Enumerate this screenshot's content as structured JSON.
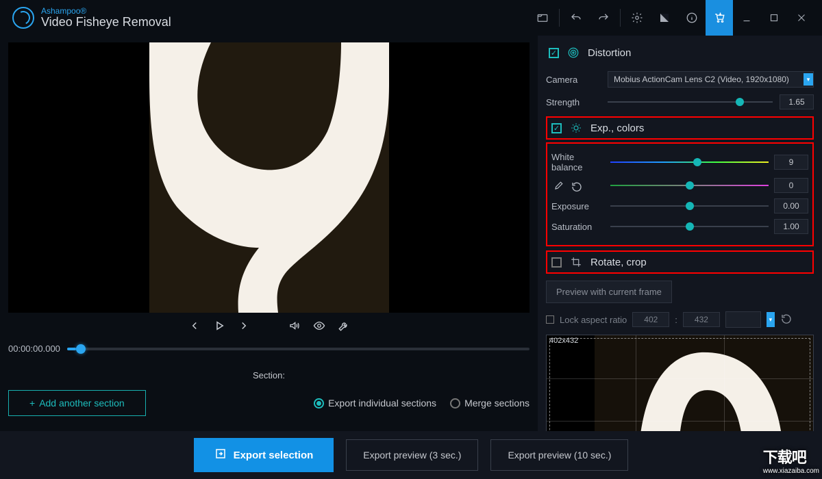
{
  "app": {
    "brand": "Ashampoo®",
    "name": "Video Fisheye Removal"
  },
  "player": {
    "timecode": "00:00:00.000",
    "progress_pct": 2
  },
  "section": {
    "heading": "Section:",
    "add_button": "Add another section",
    "radio_individual": "Export individual sections",
    "radio_merge": "Merge sections",
    "selected_radio": "individual"
  },
  "export": {
    "primary": "Export selection",
    "preview3": "Export preview (3 sec.)",
    "preview10": "Export preview (10 sec.)"
  },
  "distortion": {
    "title": "Distortion",
    "enabled": true,
    "camera_label": "Camera",
    "camera_value": "Mobius ActionCam Lens C2 (Video, 1920x1080)",
    "strength_label": "Strength",
    "strength_value": "1.65",
    "strength_pct": 80
  },
  "colors": {
    "title": "Exp., colors",
    "enabled": true,
    "wb_label": "White balance",
    "wb1_value": "9",
    "wb1_pct": 55,
    "wb2_value": "0",
    "wb2_pct": 50,
    "exposure_label": "Exposure",
    "exposure_value": "0.00",
    "exposure_pct": 50,
    "saturation_label": "Saturation",
    "saturation_value": "1.00",
    "saturation_pct": 50
  },
  "crop": {
    "title": "Rotate, crop",
    "enabled": false,
    "preview_btn": "Preview with current frame",
    "aspect_label": "Lock aspect ratio",
    "width": "402",
    "height": "432",
    "dim_text": "402x432"
  },
  "icons": {
    "open": "open-file",
    "undo": "undo",
    "redo": "redo",
    "settings": "gear",
    "theme": "theme",
    "info": "info",
    "cart": "cart",
    "minimize": "min",
    "maximize": "max",
    "close": "close"
  },
  "watermark": {
    "text": "下载吧",
    "url": "www.xiazaiba.com"
  }
}
